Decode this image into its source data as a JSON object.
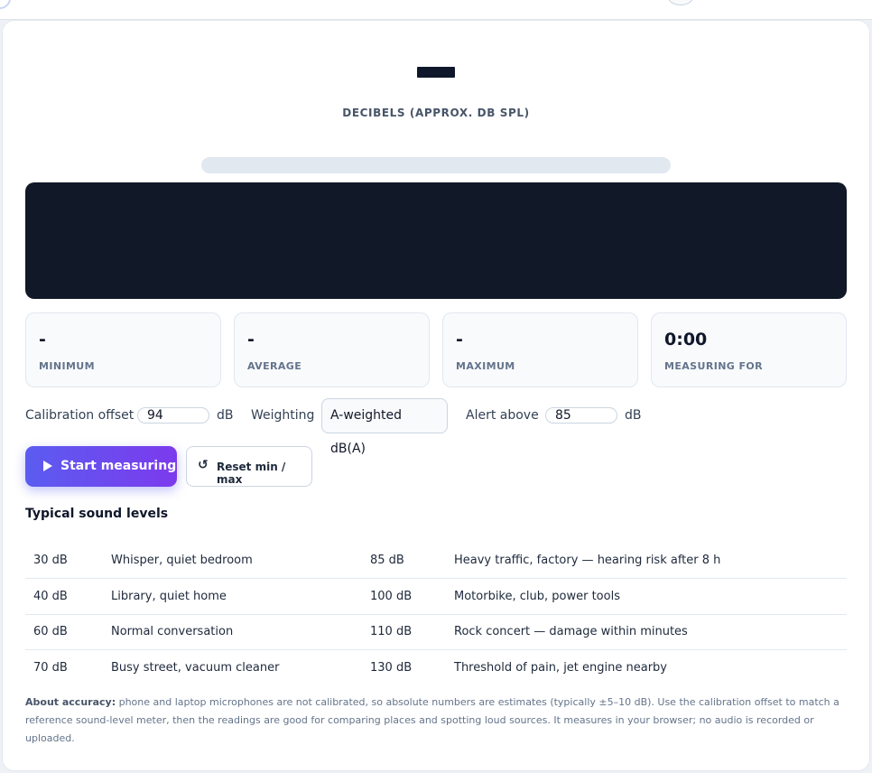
{
  "meter": {
    "unit_label": "DECIBELS (APPROX. DB SPL)"
  },
  "stats": [
    {
      "value": "-",
      "label": "MINIMUM"
    },
    {
      "value": "-",
      "label": "AVERAGE"
    },
    {
      "value": "-",
      "label": "MAXIMUM"
    },
    {
      "value": "0:00",
      "label": "MEASURING FOR"
    }
  ],
  "controls": {
    "calibration_label": "Calibration offset",
    "calibration_value": "94",
    "calibration_unit": "dB",
    "weighting_label": "Weighting",
    "weighting_value": "A-weighted dB(A)",
    "alert_label": "Alert above",
    "alert_value": "85",
    "alert_unit": "dB"
  },
  "buttons": {
    "start_label": "Start measuring",
    "reset_label": "Reset min / max",
    "reset_icon": "↺"
  },
  "levels": {
    "title": "Typical sound levels",
    "rows": [
      {
        "db_a": "30 dB",
        "desc_a": "Whisper, quiet bedroom",
        "db_b": "85 dB",
        "desc_b": "Heavy traffic, factory — hearing risk after 8 h"
      },
      {
        "db_a": "40 dB",
        "desc_a": "Library, quiet home",
        "db_b": "100 dB",
        "desc_b": "Motorbike, club, power tools"
      },
      {
        "db_a": "60 dB",
        "desc_a": "Normal conversation",
        "db_b": "110 dB",
        "desc_b": "Rock concert — damage within minutes"
      },
      {
        "db_a": "70 dB",
        "desc_a": "Busy street, vacuum cleaner",
        "db_b": "130 dB",
        "desc_b": "Threshold of pain, jet engine nearby"
      }
    ]
  },
  "note": {
    "label": "About accuracy:",
    "text": " phone and laptop microphones are not calibrated, so absolute numbers are estimates (typically ±5–10 dB). Use the calibration offset to match a reference sound-level meter, then the readings are good for comparing places and spotting loud sources. It measures in your browser; no audio is recorded or uploaded."
  }
}
